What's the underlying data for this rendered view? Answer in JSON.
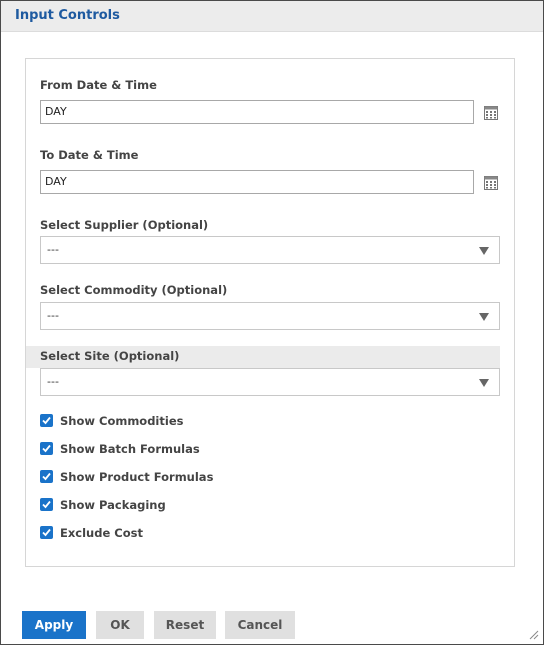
{
  "header": {
    "title": "Input Controls"
  },
  "fields": {
    "from": {
      "label": "From Date & Time",
      "value": "DAY",
      "icon": "calendar-icon"
    },
    "to": {
      "label": "To Date & Time",
      "value": "DAY",
      "icon": "calendar-icon"
    },
    "supplier": {
      "label": "Select Supplier (Optional)",
      "value": "---"
    },
    "commodity": {
      "label": "Select Commodity (Optional)",
      "value": "---"
    },
    "site": {
      "label": "Select Site (Optional)",
      "value": "---"
    }
  },
  "checkboxes": [
    {
      "label": "Show Commodities",
      "checked": true
    },
    {
      "label": "Show Batch Formulas",
      "checked": true
    },
    {
      "label": "Show Product Formulas",
      "checked": true
    },
    {
      "label": "Show Packaging",
      "checked": true
    },
    {
      "label": "Exclude Cost",
      "checked": true
    }
  ],
  "buttons": {
    "apply": "Apply",
    "ok": "OK",
    "reset": "Reset",
    "cancel": "Cancel"
  },
  "colors": {
    "accent": "#1a73c9",
    "title": "#1e5aa0",
    "header_bg": "#ececec"
  }
}
